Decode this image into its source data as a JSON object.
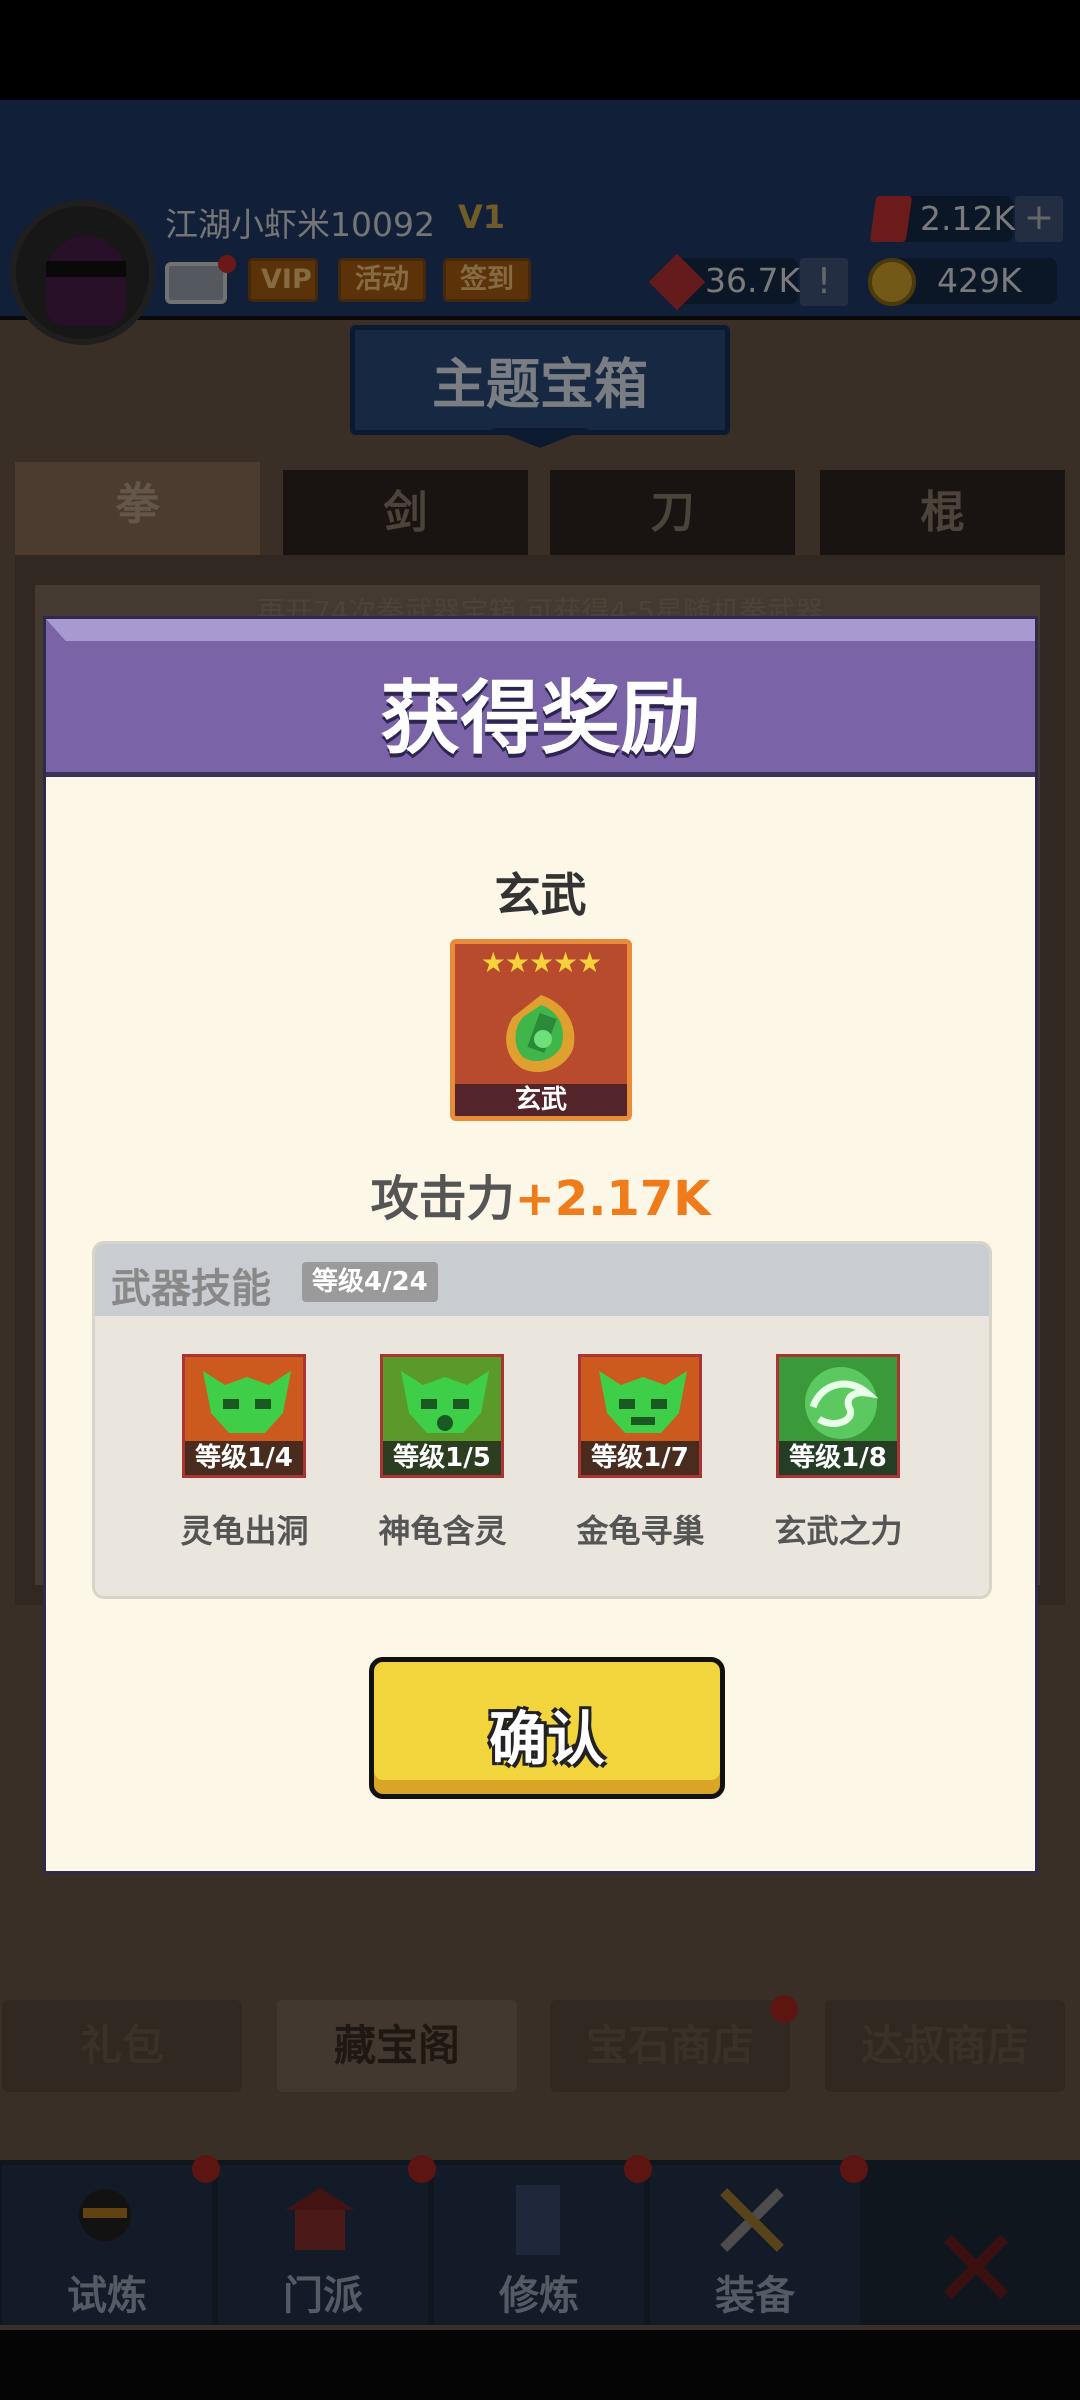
{
  "header": {
    "username": "江湖小虾米10092",
    "vip_level": "V1",
    "pills": [
      "VIP",
      "活动",
      "签到"
    ],
    "gems": "2.12K",
    "plus": "+",
    "tokens": "36.7K",
    "excl": "!",
    "coins": "429K"
  },
  "banner": {
    "title": "主题宝箱"
  },
  "category_tabs": [
    "拳",
    "剑",
    "刀",
    "棍"
  ],
  "hint": "再开74次拳武器宝箱 可获得4-5星随机拳武器",
  "shop_tabs": [
    "礼包",
    "藏宝阁",
    "宝石商店",
    "达叔商店"
  ],
  "bottom_nav": [
    "试炼",
    "门派",
    "修炼",
    "装备"
  ],
  "modal": {
    "title": "获得奖励",
    "item_name": "玄武",
    "stars": "★★★★★",
    "card_label": "玄武",
    "attack_label": "攻击力",
    "attack_value": "+2.17K",
    "skills_title": "武器技能",
    "skills_level": "等级4/24",
    "skills": [
      {
        "level": "等级1/4",
        "name": "灵龟出洞"
      },
      {
        "level": "等级1/5",
        "name": "神龟含灵"
      },
      {
        "level": "等级1/7",
        "name": "金龟寻巢"
      },
      {
        "level": "等级1/8",
        "name": "玄武之力"
      }
    ],
    "confirm_label": "确认"
  },
  "colors": {
    "accent_purple": "#7b63a8",
    "confirm_yellow": "#f2d43c",
    "attack_orange": "#ef7b1a"
  },
  "icons": [
    "avatar",
    "mail-icon",
    "gem-icon",
    "token-icon",
    "coin-icon",
    "weapon-icon",
    "turtle-mask-icon",
    "dragon-icon",
    "close-icon"
  ]
}
